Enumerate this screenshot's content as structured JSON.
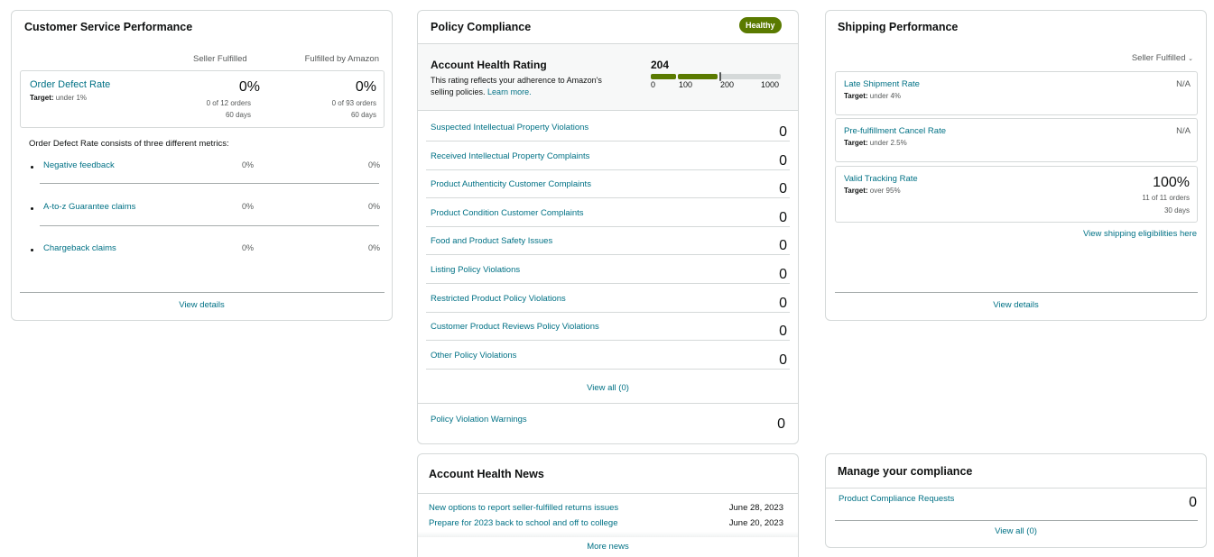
{
  "customer_service": {
    "title": "Customer Service Performance",
    "col_seller": "Seller Fulfilled",
    "col_fba": "Fulfilled by Amazon",
    "odr": {
      "label": "Order Defect Rate",
      "target_prefix": "Target:",
      "target_value": "under 1%",
      "seller_pct": "0%",
      "seller_orders": "0 of 12 orders",
      "seller_days": "60 days",
      "fba_pct": "0%",
      "fba_orders": "0 of 93 orders",
      "fba_days": "60 days"
    },
    "consists_text": "Order Defect Rate consists of three different metrics:",
    "metrics": [
      {
        "label": "Negative feedback",
        "seller": "0%",
        "fba": "0%"
      },
      {
        "label": "A-to-z Guarantee claims",
        "seller": "0%",
        "fba": "0%"
      },
      {
        "label": "Chargeback claims",
        "seller": "0%",
        "fba": "0%"
      }
    ],
    "view_details": "View details"
  },
  "policy": {
    "title": "Policy Compliance",
    "badge": "Healthy",
    "badge_color": "#5a7a00",
    "ahr_title": "Account Health Rating",
    "ahr_desc": "This rating reflects your adherence to Amazon's selling policies.",
    "ahr_learn": "Learn more.",
    "ahr_score": "204",
    "ahr_ticks": [
      "0",
      "100",
      "200",
      "1000"
    ],
    "violations": [
      {
        "label": "Suspected Intellectual Property Violations",
        "value": "0"
      },
      {
        "label": "Received Intellectual Property Complaints",
        "value": "0"
      },
      {
        "label": "Product Authenticity Customer Complaints",
        "value": "0"
      },
      {
        "label": "Product Condition Customer Complaints",
        "value": "0"
      },
      {
        "label": "Food and Product Safety Issues",
        "value": "0"
      },
      {
        "label": "Listing Policy Violations",
        "value": "0"
      },
      {
        "label": "Restricted Product Policy Violations",
        "value": "0"
      },
      {
        "label": "Customer Product Reviews Policy Violations",
        "value": "0"
      },
      {
        "label": "Other Policy Violations",
        "value": "0"
      }
    ],
    "view_all": "View all (0)",
    "warnings_label": "Policy Violation Warnings",
    "warnings_value": "0"
  },
  "shipping": {
    "title": "Shipping Performance",
    "dropdown": "Seller Fulfilled",
    "late": {
      "label": "Late Shipment Rate",
      "target_prefix": "Target:",
      "target_value": "under 4%",
      "value": "N/A"
    },
    "cancel": {
      "label": "Pre-fulfillment Cancel Rate",
      "target_prefix": "Target:",
      "target_value": "under 2.5%",
      "value": "N/A"
    },
    "tracking": {
      "label": "Valid Tracking Rate",
      "target_prefix": "Target:",
      "target_value": "over 95%",
      "value": "100%",
      "orders": "11 of 11 orders",
      "days": "30 days"
    },
    "eligibility_link": "View shipping eligibilities here",
    "view_details": "View details"
  },
  "news": {
    "title": "Account Health News",
    "items": [
      {
        "label": "New options to report seller-fulfilled returns issues",
        "date": "June 28, 2023"
      },
      {
        "label": "Prepare for 2023 back to school and off to college",
        "date": "June 20, 2023"
      }
    ],
    "more": "More news"
  },
  "compliance": {
    "title": "Manage your compliance",
    "item_label": "Product Compliance Requests",
    "item_value": "0",
    "view_all": "View all (0)"
  }
}
